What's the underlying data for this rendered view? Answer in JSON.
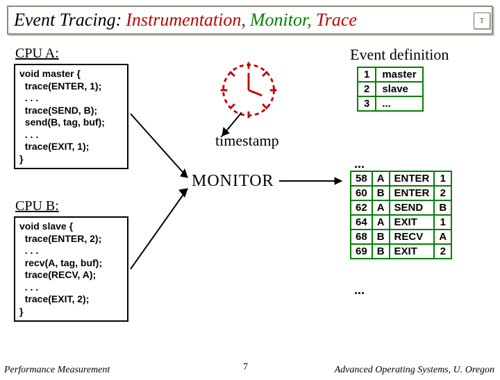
{
  "title": {
    "w1": "Event Tracing:",
    "w2": "Instrumentation,",
    "w3": "Monitor,",
    "w4": "Trace"
  },
  "logo_glyph": "T",
  "cpu_a_label": "CPU A:",
  "cpu_b_label": "CPU B:",
  "code_a": [
    "void master {",
    "  trace(ENTER, 1);",
    "  . . .",
    "  trace(SEND, B);",
    "  send(B, tag, buf);",
    "  . . .",
    "  trace(EXIT, 1);",
    "}"
  ],
  "code_b": [
    "void slave {",
    "  trace(ENTER, 2);",
    "  . . .",
    "  recv(A, tag, buf);",
    "  trace(RECV, A);",
    "  . . .",
    "  trace(EXIT, 2);",
    "}"
  ],
  "timestamp_label": "timestamp",
  "monitor_label": "MONITOR",
  "event_def_label": "Event definition",
  "event_defs": [
    {
      "id": "1",
      "name": "master"
    },
    {
      "id": "2",
      "name": "slave"
    },
    {
      "id": "3",
      "name": "..."
    }
  ],
  "trace_pre_ellipsis": "...",
  "trace_rows": [
    {
      "t": "58",
      "cpu": "A",
      "ev": "ENTER",
      "arg": "1"
    },
    {
      "t": "60",
      "cpu": "B",
      "ev": "ENTER",
      "arg": "2"
    },
    {
      "t": "62",
      "cpu": "A",
      "ev": "SEND",
      "arg": "B"
    },
    {
      "t": "64",
      "cpu": "A",
      "ev": "EXIT",
      "arg": "1"
    },
    {
      "t": "68",
      "cpu": "B",
      "ev": "RECV",
      "arg": "A"
    },
    {
      "t": "69",
      "cpu": "B",
      "ev": "EXIT",
      "arg": "2"
    }
  ],
  "trace_post_ellipsis": "...",
  "slide_number": "7",
  "footer_left": "Performance Measurement",
  "footer_right": "Advanced Operating Systems, U. Oregon"
}
